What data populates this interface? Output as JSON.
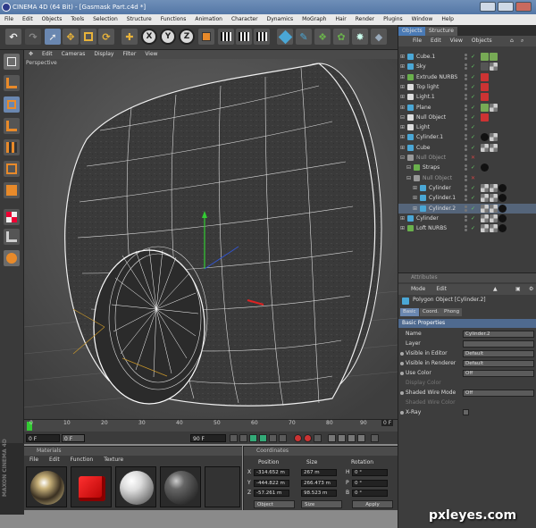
{
  "window": {
    "title": "CINEMA 4D (64 Bit) - [Gasmask Part.c4d *]"
  },
  "menubar": [
    "File",
    "Edit",
    "Objects",
    "Tools",
    "Selection",
    "Structure",
    "Functions",
    "Animation",
    "Character",
    "Dynamics",
    "MoGraph",
    "Hair",
    "Render",
    "Plugins",
    "Window",
    "Help"
  ],
  "toolbar": {
    "x_label": "X",
    "y_label": "Y",
    "z_label": "Z"
  },
  "viewport": {
    "menu": [
      "Edit",
      "Cameras",
      "Display",
      "Filter",
      "View"
    ],
    "label": "Perspective"
  },
  "timeline": {
    "ticks": [
      "0",
      "10",
      "20",
      "30",
      "40",
      "50",
      "60",
      "70",
      "80",
      "90"
    ],
    "end_label": "0 F"
  },
  "frames": {
    "current": "0 F",
    "start": "0 F",
    "end": "90 F",
    "current_right": "0 F"
  },
  "materials": {
    "header": "Materials",
    "menu": [
      "File",
      "Edit",
      "Function",
      "Texture"
    ]
  },
  "coordinates": {
    "header": "Coordinates",
    "col_position": "Position",
    "col_size": "Size",
    "col_rotation": "Rotation",
    "rows": [
      {
        "axis": "X",
        "pos": "-314.652 m",
        "size": "267 m",
        "rot_label": "H",
        "rot": "0 °"
      },
      {
        "axis": "Y",
        "pos": "-444.822 m",
        "size": "266.473 m",
        "rot_label": "P",
        "rot": "0 °"
      },
      {
        "axis": "Z",
        "pos": "-57.261 m",
        "size": "98.523 m",
        "rot_label": "B",
        "rot": "0 °"
      }
    ],
    "mode": "Object",
    "size_mode": "Size",
    "apply": "Apply"
  },
  "objects": {
    "tabs": [
      "Objects",
      "Structure"
    ],
    "menu": [
      "File",
      "Edit",
      "View",
      "Objects"
    ],
    "items": [
      {
        "name": "Cube.1",
        "color": "#4aa7d6"
      },
      {
        "name": "Sky",
        "color": "#4aa7d6"
      },
      {
        "name": "Extrude NURBS",
        "color": "#6ab04c"
      },
      {
        "name": "Top light",
        "color": "#dddddd"
      },
      {
        "name": "Light.1",
        "color": "#dddddd"
      },
      {
        "name": "Plane",
        "color": "#4aa7d6"
      },
      {
        "name": "Null Object",
        "color": "#dddddd"
      },
      {
        "name": "Light",
        "color": "#dddddd"
      },
      {
        "name": "Cylinder.1",
        "color": "#4aa7d6"
      },
      {
        "name": "Cube",
        "color": "#4aa7d6"
      },
      {
        "name": "Null Object",
        "color": "#999999"
      },
      {
        "name": "Straps",
        "color": "#6ab04c"
      },
      {
        "name": "Null Object",
        "color": "#999999"
      },
      {
        "name": "Cylinder",
        "color": "#4aa7d6"
      },
      {
        "name": "Cylinder.1",
        "color": "#4aa7d6"
      },
      {
        "name": "Cylinder.2",
        "color": "#4aa7d6"
      },
      {
        "name": "Cylinder",
        "color": "#4aa7d6"
      },
      {
        "name": "Loft NURBS",
        "color": "#6ab04c"
      }
    ]
  },
  "attributes": {
    "header": "Attributes",
    "menu": [
      "Mode",
      "Edit"
    ],
    "object_title": "Polygon Object [Cylinder.2]",
    "tabs": [
      "Basic",
      "Coord.",
      "Phong"
    ],
    "section": "Basic Properties",
    "fields": [
      {
        "label": "Name",
        "value": "Cylinder.2"
      },
      {
        "label": "Layer",
        "value": ""
      },
      {
        "label": "Visible in Editor",
        "value": "Default"
      },
      {
        "label": "Visible in Renderer",
        "value": "Default"
      },
      {
        "label": "Use Color",
        "value": "Off"
      },
      {
        "label": "Display Color",
        "value": ""
      },
      {
        "label": "Shaded Wire Mode",
        "value": "Off"
      },
      {
        "label": "Shaded Wire Color",
        "value": ""
      },
      {
        "label": "X-Ray",
        "value": ""
      }
    ]
  },
  "watermark": "pxleyes.com",
  "colors": {
    "accent": "#4a7ab5",
    "selection": "#6a87b0",
    "tag_red": "#c33",
    "tag_black": "#111"
  }
}
